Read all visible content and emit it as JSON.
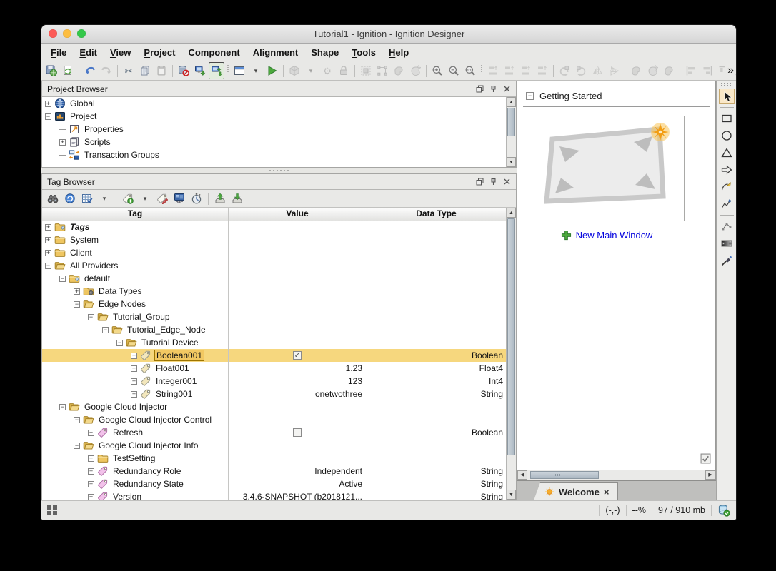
{
  "window": {
    "title": "Tutorial1 - Ignition - Ignition Designer"
  },
  "menu": {
    "items": [
      {
        "label": "File",
        "mnemonic": "F"
      },
      {
        "label": "Edit",
        "mnemonic": "E"
      },
      {
        "label": "View",
        "mnemonic": "V"
      },
      {
        "label": "Project",
        "mnemonic": "P"
      },
      {
        "label": "Component",
        "mnemonic": ""
      },
      {
        "label": "Alignment",
        "mnemonic": ""
      },
      {
        "label": "Shape",
        "mnemonic": ""
      },
      {
        "label": "Tools",
        "mnemonic": "T"
      },
      {
        "label": "Help",
        "mnemonic": "H"
      }
    ]
  },
  "main_toolbar": {
    "items": [
      {
        "name": "save-button",
        "kind": "save"
      },
      {
        "name": "update-project-button",
        "kind": "pagerefresh"
      },
      {
        "name": "sep"
      },
      {
        "name": "undo-button",
        "kind": "undo"
      },
      {
        "name": "redo-button",
        "kind": "redo",
        "dim": true
      },
      {
        "name": "sep"
      },
      {
        "name": "cut-button",
        "kind": "cut"
      },
      {
        "name": "copy-button",
        "kind": "copy"
      },
      {
        "name": "paste-button",
        "kind": "paste",
        "dim": true
      },
      {
        "name": "sep"
      },
      {
        "name": "db-pending-changes-button",
        "kind": "dbno"
      },
      {
        "name": "db-download-button",
        "kind": "dbdown"
      },
      {
        "name": "db-sync-button",
        "kind": "dbsync",
        "boxed": true
      },
      {
        "name": "dotsep"
      },
      {
        "name": "open-window-button",
        "kind": "window"
      },
      {
        "name": "open-window-dropdown",
        "kind": "caret"
      },
      {
        "name": "preview-mode-button",
        "kind": "play"
      },
      {
        "name": "sep"
      },
      {
        "name": "group-button",
        "kind": "cube",
        "dim": true
      },
      {
        "name": "group-dropdown",
        "kind": "caret",
        "dim": true
      },
      {
        "name": "merge-button",
        "kind": "gears",
        "dim": true
      },
      {
        "name": "lock-button",
        "kind": "lock",
        "dim": true
      },
      {
        "name": "sep"
      },
      {
        "name": "deep-select-button",
        "kind": "selrect",
        "dim": true
      },
      {
        "name": "marquee-select-button",
        "kind": "selhandles",
        "dim": true
      },
      {
        "name": "lasso-select-button",
        "kind": "blob",
        "dim": true
      },
      {
        "name": "magic-wand-button",
        "kind": "blob2",
        "dim": true
      },
      {
        "name": "sep"
      },
      {
        "name": "zoom-in-button",
        "kind": "zoomin"
      },
      {
        "name": "zoom-out-button",
        "kind": "zoomout"
      },
      {
        "name": "zoom-actual-button",
        "kind": "zoom11"
      },
      {
        "name": "dotsep"
      },
      {
        "name": "size-match-button",
        "kind": "bars",
        "dim": true
      },
      {
        "name": "size-width-button",
        "kind": "bars",
        "dim": true
      },
      {
        "name": "size-height-button",
        "kind": "bars",
        "dim": true
      },
      {
        "name": "size-both-button",
        "kind": "bars",
        "dim": true
      },
      {
        "name": "sep"
      },
      {
        "name": "rotate-ccw-button",
        "kind": "rotl",
        "dim": true
      },
      {
        "name": "rotate-cw-button",
        "kind": "rotr",
        "dim": true
      },
      {
        "name": "flip-horizontal-button",
        "kind": "fliph",
        "dim": true
      },
      {
        "name": "flip-vertical-button",
        "kind": "flipv",
        "dim": true
      },
      {
        "name": "sep"
      },
      {
        "name": "shape-union-button",
        "kind": "blob",
        "dim": true
      },
      {
        "name": "shape-difference-button",
        "kind": "blob2",
        "dim": true
      },
      {
        "name": "shape-intersect-button",
        "kind": "blob",
        "dim": true
      },
      {
        "name": "sep"
      },
      {
        "name": "align-left-button",
        "kind": "alignl",
        "dim": true
      },
      {
        "name": "align-right-button",
        "kind": "alignr",
        "dim": true
      },
      {
        "name": "align-top-button",
        "kind": "alignt",
        "dim": true
      },
      {
        "name": "align-bottom-button",
        "kind": "alignb",
        "dim": true
      },
      {
        "name": "align-center-button",
        "kind": "alignc",
        "dim": true
      }
    ],
    "overflow_glyph": "»"
  },
  "project_browser": {
    "title": "Project Browser",
    "rows": [
      {
        "label": "Global",
        "level": 0,
        "expand": "+",
        "icon": "globe"
      },
      {
        "label": "Project",
        "level": 0,
        "expand": "-",
        "icon": "chart"
      },
      {
        "label": "Properties",
        "level": 1,
        "expand": null,
        "icon": "properties"
      },
      {
        "label": "Scripts",
        "level": 1,
        "expand": "+",
        "icon": "scripts"
      },
      {
        "label": "Transaction Groups",
        "level": 1,
        "expand": null,
        "icon": "transaction"
      }
    ]
  },
  "tag_browser": {
    "title": "Tag Browser",
    "toolbar": [
      {
        "name": "browse-tags-button",
        "kind": "binoculars"
      },
      {
        "name": "refresh-tags-button",
        "kind": "bluerefresh"
      },
      {
        "name": "tag-report-button",
        "kind": "gridcheck"
      },
      {
        "name": "tag-report-dropdown",
        "kind": "caret"
      },
      {
        "name": "sep"
      },
      {
        "name": "add-tag-button",
        "kind": "tagadd"
      },
      {
        "name": "add-tag-dropdown",
        "kind": "caret"
      },
      {
        "name": "edit-tag-button",
        "kind": "tagedit"
      },
      {
        "name": "opc-browse-button",
        "kind": "opc"
      },
      {
        "name": "refresh-rate-button",
        "kind": "stopwatch"
      },
      {
        "name": "sep"
      },
      {
        "name": "import-tags-button",
        "kind": "importtray"
      },
      {
        "name": "export-tags-button",
        "kind": "exporttray"
      }
    ],
    "columns": [
      "Tag",
      "Value",
      "Data Type"
    ],
    "rows": [
      {
        "label": "Tags",
        "level": 0,
        "expand": "+",
        "icon": "foldertag",
        "bold": true
      },
      {
        "label": "System",
        "level": 0,
        "expand": "+",
        "icon": "folder"
      },
      {
        "label": "Client",
        "level": 0,
        "expand": "+",
        "icon": "folder"
      },
      {
        "label": "All Providers",
        "level": 0,
        "expand": "-",
        "icon": "folderopen"
      },
      {
        "label": "default",
        "level": 1,
        "expand": "-",
        "icon": "foldertag"
      },
      {
        "label": "Data Types",
        "level": 2,
        "expand": "+",
        "icon": "foldertypes"
      },
      {
        "label": "Edge Nodes",
        "level": 2,
        "expand": "-",
        "icon": "folderopen"
      },
      {
        "label": "Tutorial_Group",
        "level": 3,
        "expand": "-",
        "icon": "folderopen"
      },
      {
        "label": "Tutorial_Edge_Node",
        "level": 4,
        "expand": "-",
        "icon": "folderopen"
      },
      {
        "label": "Tutorial Device",
        "level": 5,
        "expand": "-",
        "icon": "folderopen"
      },
      {
        "label": "Boolean001",
        "level": 6,
        "expand": "+",
        "icon": "tag",
        "selected": true,
        "value_check": true,
        "type": "Boolean"
      },
      {
        "label": "Float001",
        "level": 6,
        "expand": "+",
        "icon": "tag",
        "value": "1.23",
        "type": "Float4"
      },
      {
        "label": "Integer001",
        "level": 6,
        "expand": "+",
        "icon": "tag",
        "value": "123",
        "type": "Int4"
      },
      {
        "label": "String001",
        "level": 6,
        "expand": "+",
        "icon": "tag",
        "value": "onetwothree",
        "type": "String"
      },
      {
        "label": "Google Cloud Injector",
        "level": 1,
        "expand": "-",
        "icon": "folderopen"
      },
      {
        "label": "Google Cloud Injector Control",
        "level": 2,
        "expand": "-",
        "icon": "folderopen"
      },
      {
        "label": "Refresh",
        "level": 3,
        "expand": "+",
        "icon": "tagpink",
        "value_check": false,
        "type": "Boolean"
      },
      {
        "label": "Google Cloud Injector Info",
        "level": 2,
        "expand": "-",
        "icon": "folderopen"
      },
      {
        "label": "TestSetting",
        "level": 3,
        "expand": "+",
        "icon": "folder"
      },
      {
        "label": "Redundancy Role",
        "level": 3,
        "expand": "+",
        "icon": "tagpink",
        "value": "Independent",
        "type": "String"
      },
      {
        "label": "Redundancy State",
        "level": 3,
        "expand": "+",
        "icon": "tagpink",
        "value": "Active",
        "type": "String"
      },
      {
        "label": "Version",
        "level": 3,
        "expand": "+",
        "icon": "tagpink",
        "value": "3.4.6-SNAPSHOT (b2018121...",
        "type": "String"
      }
    ]
  },
  "getting_started": {
    "collapse_glyph": "−",
    "title": "Getting Started",
    "new_window_label": "New Main Window"
  },
  "welcome_tab": {
    "label": "Welcome",
    "close_glyph": "×"
  },
  "palette": {
    "tools": [
      {
        "name": "selection-tool",
        "kind": "cursor",
        "selected": true
      },
      {
        "name": "sep"
      },
      {
        "name": "rectangle-tool",
        "kind": "recttool"
      },
      {
        "name": "ellipse-tool",
        "kind": "ellipsetool"
      },
      {
        "name": "polygon-tool",
        "kind": "tritool"
      },
      {
        "name": "arrow-tool",
        "kind": "arrowtool"
      },
      {
        "name": "pen-tool",
        "kind": "pentool"
      },
      {
        "name": "pencil-tool",
        "kind": "penciltool"
      },
      {
        "name": "sep"
      },
      {
        "name": "path-edit-tool",
        "kind": "nodestool"
      },
      {
        "name": "gradient-tool",
        "kind": "gradienttool"
      },
      {
        "name": "eyedropper-tool",
        "kind": "eyedroppertool"
      }
    ]
  },
  "status_bar": {
    "coordinates": "(-,-)",
    "zoom_percent": "--%",
    "memory": "97 / 910 mb"
  },
  "colors": {
    "selection_row": "#F6D77E",
    "selection_label_border": "#9E7500",
    "link_blue": "#0000DD",
    "tool_highlight": "#FAE8C8",
    "folder_yellow": "#EFC661",
    "tag_yellow": "#F3E7BC",
    "tag_pink": "#F2C2EA",
    "play_green": "#4CA83C",
    "traffic_lights": [
      "#FC5B57",
      "#FDBE41",
      "#34C84A"
    ]
  }
}
